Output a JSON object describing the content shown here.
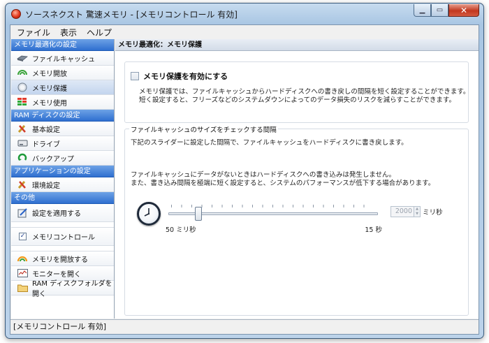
{
  "window": {
    "title": "ソースネクスト 驚速メモリ - [メモリコントロール 有効]",
    "buttons": {
      "minimize": "▁",
      "maximize": "▭",
      "close": "✕"
    }
  },
  "menubar": [
    "ファイル",
    "表示",
    "ヘルプ"
  ],
  "sidebar": {
    "section_memory": "メモリ最適化の設定",
    "memory_items": [
      {
        "label": "ファイルキャッシュ",
        "icon": "file-cache-icon"
      },
      {
        "label": "メモリ開放",
        "icon": "memory-release-icon"
      },
      {
        "label": "メモリ保護",
        "icon": "memory-protect-icon",
        "selected": true
      },
      {
        "label": "メモリ使用",
        "icon": "memory-usage-icon"
      }
    ],
    "section_ramdisk": "RAM ディスクの設定",
    "ramdisk_items": [
      {
        "label": "基本設定",
        "icon": "tools-icon"
      },
      {
        "label": "ドライブ",
        "icon": "drive-icon"
      },
      {
        "label": "バックアップ",
        "icon": "backup-icon"
      }
    ],
    "section_app": "アプリケーションの設定",
    "app_items": [
      {
        "label": "環境設定",
        "icon": "tools-icon"
      }
    ],
    "section_other": "その他",
    "apply_settings": "設定を適用する",
    "memory_control": "メモリコントロール",
    "memory_control_checked": true,
    "release_memory": "メモリを開放する",
    "open_monitor": "モニターを開く",
    "open_ramdisk_folder": "RAM ディスクフォルダを開く"
  },
  "main": {
    "header": "メモリ最適化：メモリ保護",
    "enable_label": "メモリ保護を有効にする",
    "enable_checked": false,
    "description_line1": "メモリ保護では、ファイルキャッシュからハードディスクへの書き戻しの間隔を短く設定することができます。",
    "description_line2": "短く設定すると、フリーズなどのシステムダウンによってのデータ損失のリスクを減らすことができます。",
    "interval_group_title": "ファイルキャッシュのサイズをチェックする間隔",
    "interval_text1": "下記のスライダーに設定した間隔で、ファイルキャッシュをハードディスクに書き戻します。",
    "interval_text2": "ファイルキャッシュにデータがないときはハードディスクへの書き込みは発生しません。",
    "interval_text3": "また、書き込み間隔を極端に短く設定すると、システムのパフォーマンスが低下する場合があります。",
    "slider_min_label": "50 ミリ秒",
    "slider_max_label": "15 秒",
    "slider_fraction": 0.13,
    "spin_value": "2000",
    "spin_unit": "ミリ秒"
  },
  "status": "[メモリコントロール 有効]"
}
